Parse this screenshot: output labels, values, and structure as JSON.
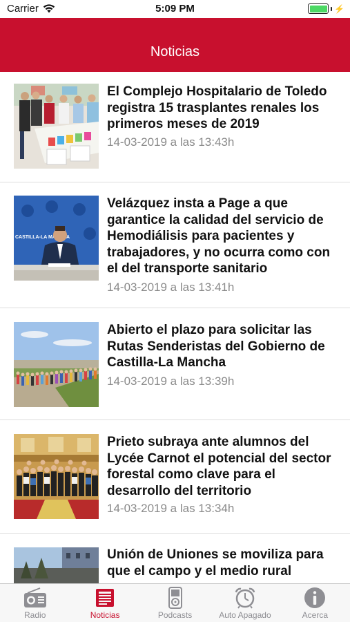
{
  "status_bar": {
    "carrier": "Carrier",
    "time": "5:09 PM"
  },
  "nav": {
    "title": "Noticias"
  },
  "news": [
    {
      "headline": "El Complejo Hospitalario de Toledo registra 15 trasplantes renales los primeros meses de 2019",
      "date": "14-03-2019 a las 13:43h"
    },
    {
      "headline": "Velázquez insta a Page a que garantice la calidad del servicio de Hemodiálisis para pacientes y trabajadores, y no ocurra como con el del transporte sanitario",
      "date": "14-03-2019 a las 13:41h",
      "photo_banner": "CASTILLA-LA MANCHA"
    },
    {
      "headline": "Abierto el plazo para solicitar las Rutas Senderistas del Gobierno de Castilla-La Mancha",
      "date": "14-03-2019 a las 13:39h"
    },
    {
      "headline": "Prieto subraya ante alumnos del Lycée Carnot el potencial del sector forestal como clave para el desarrollo del territorio",
      "date": "14-03-2019 a las 13:34h"
    },
    {
      "headline": "Unión de Uniones se moviliza para que el campo y el medio rural",
      "date": ""
    }
  ],
  "tabs": [
    {
      "label": "Radio",
      "icon": "radio-icon",
      "active": false
    },
    {
      "label": "Noticias",
      "icon": "newspaper-icon",
      "active": true
    },
    {
      "label": "Podcasts",
      "icon": "ipod-icon",
      "active": false
    },
    {
      "label": "Auto Apagado",
      "icon": "alarm-clock-icon",
      "active": false
    },
    {
      "label": "Acerca",
      "icon": "info-icon",
      "active": false
    }
  ],
  "colors": {
    "brand_red": "#c8102e",
    "tab_inactive": "#8e8e93",
    "date_gray": "#8a8a8a"
  }
}
